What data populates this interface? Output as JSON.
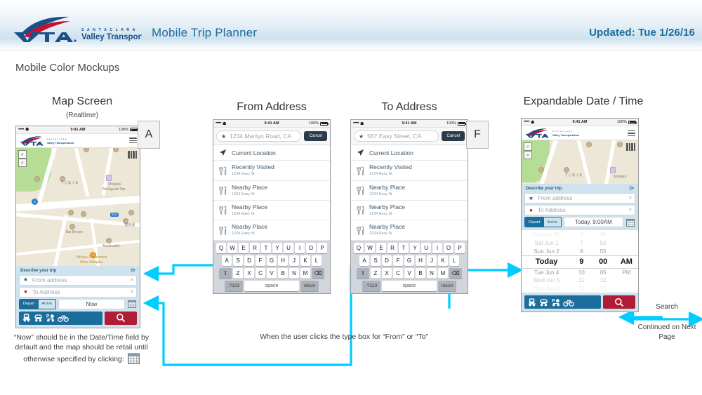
{
  "header": {
    "logo_name": "vta-logo",
    "logo_sub_small": "S A N T A   C L A R A",
    "logo_sub": "Valley Transportation Authority",
    "title": "Mobile Trip Planner",
    "updated": "Updated: Tue 1/26/16",
    "accent_color": "#1b6d9c"
  },
  "slide": {
    "title": "Mobile Color Mockups",
    "connector_color": "#00ccff"
  },
  "panels": [
    {
      "id": "map-screen",
      "heading": "Map Screen",
      "subheading": "(Realtime)",
      "letter": "A"
    },
    {
      "id": "from-address",
      "heading": "From Address",
      "subheading": "",
      "letter": ""
    },
    {
      "id": "to-address",
      "heading": "To Address",
      "subheading": "",
      "letter": "F"
    },
    {
      "id": "expandable-date-time",
      "heading": "Expandable Date / Time",
      "subheading": "",
      "letter": ""
    }
  ],
  "statusbar": {
    "signal": "•••••",
    "time": "9:41 AM",
    "battery": "100%"
  },
  "map": {
    "labels": [
      "てじまぅる",
      "Shinjuku",
      "Nishiguchi Sta.",
      "Bar Eleven",
      "Mcdonald's",
      "Odakyu Department",
      "Store Shinjuku",
      "越後屋"
    ],
    "shields": [
      "4",
      "414"
    ],
    "zoom_in": "+",
    "zoom_out": "−"
  },
  "tripform": {
    "header": "Describe your trip",
    "refresh_icon": "refresh-icon",
    "from_placeholder": "From address",
    "to_placeholder": "To Address",
    "clear_icon": "×",
    "depart_label": "Depart",
    "arrive_label": "Arrive",
    "time_now": "Now",
    "time_today": "Today, 9:00AM",
    "calendar_icon": "calendar-icon",
    "modes": [
      "train-icon",
      "bus-icon",
      "park-and-ride-icon",
      "bicycle-icon"
    ],
    "search_icon": "search-icon",
    "mode_bar_color": "#1b6d9c",
    "search_color": "#b01c36"
  },
  "address_screens": [
    {
      "id": "from",
      "input_value": "1234 Marilyn Road, CA",
      "cancel_label": "Cancel",
      "items": [
        {
          "title": "Current Location",
          "sub": "",
          "icon": "navigation-arrow-icon"
        },
        {
          "title": "Recently Visited",
          "sub": "1234 Easy St",
          "icon": "restaurant-icon"
        },
        {
          "title": "Nearby Place",
          "sub": "1234 Easy St",
          "icon": "restaurant-icon"
        },
        {
          "title": "Nearby Place",
          "sub": "1234 Easy St",
          "icon": "restaurant-icon"
        },
        {
          "title": "Nearby Place",
          "sub": "1234 Easy St",
          "icon": "restaurant-icon"
        }
      ]
    },
    {
      "id": "to",
      "input_value": "567 Easy Street, CA",
      "cancel_label": "Cancel",
      "items": [
        {
          "title": "Current Location",
          "sub": "",
          "icon": "navigation-arrow-icon"
        },
        {
          "title": "Recently Visited",
          "sub": "1234 Easy St",
          "icon": "restaurant-icon"
        },
        {
          "title": "Nearby Place",
          "sub": "1234 Easy St",
          "icon": "restaurant-icon"
        },
        {
          "title": "Nearby Place",
          "sub": "1234 Easy St",
          "icon": "restaurant-icon"
        },
        {
          "title": "Nearby Place",
          "sub": "1234 Easy St",
          "icon": "restaurant-icon"
        }
      ]
    }
  ],
  "keyboard": {
    "row1": [
      "Q",
      "W",
      "E",
      "R",
      "T",
      "Y",
      "U",
      "I",
      "O",
      "P"
    ],
    "row2": [
      "A",
      "S",
      "D",
      "F",
      "G",
      "H",
      "J",
      "K",
      "L"
    ],
    "row3": [
      "Z",
      "X",
      "C",
      "V",
      "B",
      "N",
      "M"
    ],
    "shift": "⇧",
    "backspace": "⌫",
    "numeric": ".?123",
    "space": "space",
    "return": "return"
  },
  "datepicker": {
    "rows": [
      {
        "day": "Fri May 31",
        "hour": "6",
        "minute": "45",
        "ampm": "",
        "state": "far"
      },
      {
        "day": "Sat Jun 1",
        "hour": "7",
        "minute": "50",
        "ampm": "",
        "state": "mid"
      },
      {
        "day": "Sun Jun 2",
        "hour": "8",
        "minute": "55",
        "ampm": "",
        "state": "near"
      },
      {
        "day": "Today",
        "hour": "9",
        "minute": "00",
        "ampm": "AM",
        "state": "selected"
      },
      {
        "day": "Tue Jun 4",
        "hour": "10",
        "minute": "05",
        "ampm": "PM",
        "state": "near"
      },
      {
        "day": "Wed Jun 5",
        "hour": "11",
        "minute": "10",
        "ampm": "",
        "state": "mid"
      },
      {
        "day": "Thu Jun 6",
        "hour": "12",
        "minute": "15",
        "ampm": "",
        "state": "far"
      }
    ]
  },
  "captions": {
    "left_note": "“Now” should be in the Date/Time field by default and the map should be retail until otherwise specified by clicking:",
    "center_note": "When the user clicks the type box for “From” or “To”",
    "search_label": "Search",
    "continued_note": "Continued on Next Page"
  }
}
